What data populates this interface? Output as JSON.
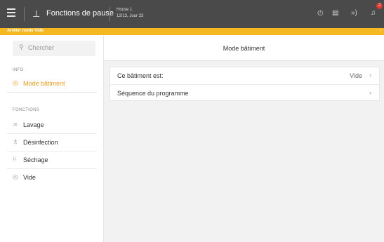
{
  "topbar": {
    "title": "Fonctions de pause",
    "house_name": "House 1",
    "house_date": "12/13, Jour 23",
    "notification_count": "2"
  },
  "notice": {
    "text": "Arrêter mode Vide"
  },
  "sidebar": {
    "search_placeholder": "Chercher",
    "info_section": "INFO",
    "info_items": [
      {
        "label": "Mode bâtiment",
        "icon": "check-circle-icon"
      }
    ],
    "functions_section": "FONCTIONS",
    "function_items": [
      {
        "label": "Lavage",
        "icon": "wash-icon"
      },
      {
        "label": "Désinfection",
        "icon": "spray-icon"
      },
      {
        "label": "Séchage",
        "icon": "drying-icon"
      },
      {
        "label": "Vide",
        "icon": "check-circle-icon"
      }
    ]
  },
  "main": {
    "title": "Mode bâtiment",
    "rows": [
      {
        "label": "Ce bâtiment est:",
        "value": "Vide"
      },
      {
        "label": "Séquence du programme",
        "value": ""
      }
    ]
  },
  "colors": {
    "accent": "#f29a1c",
    "notice_bar": "#f5b820",
    "topbar": "#4a4a4a",
    "badge": "#e03a2f"
  }
}
